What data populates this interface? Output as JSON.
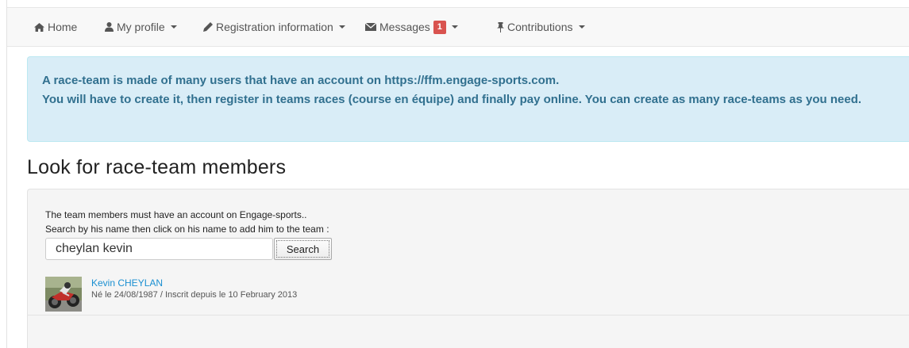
{
  "nav": {
    "home": "Home",
    "my_profile": "My profile",
    "registration": "Registration information",
    "messages": "Messages",
    "messages_count": "1",
    "contributions": "Contributions"
  },
  "alert": {
    "line1": "A race-team is made of many users that have an account on https://ffm.engage-sports.com.",
    "line2": "You will have to create it, then register in teams races (course en équipe) and finally pay online. You can create as many race-teams as you need."
  },
  "page_title": "Look for race-team members",
  "search": {
    "help_line1": "The team members must have an account on Engage-sports..",
    "help_line2": "Search by his name then click on his name to add him to the team :",
    "value": "cheylan kevin",
    "button_label": "Search"
  },
  "results": [
    {
      "name": "Kevin CHEYLAN",
      "meta": "Né le 24/08/1987 / Inscrit depuis le 10 February 2013"
    }
  ],
  "colors": {
    "alert_text": "#31708f",
    "alert_bg": "#d9edf7",
    "badge": "#d9534f",
    "link": "#1a8fd1"
  },
  "icons": [
    "home-icon",
    "user-icon",
    "pencil-icon",
    "envelope-icon",
    "pushpin-icon"
  ]
}
